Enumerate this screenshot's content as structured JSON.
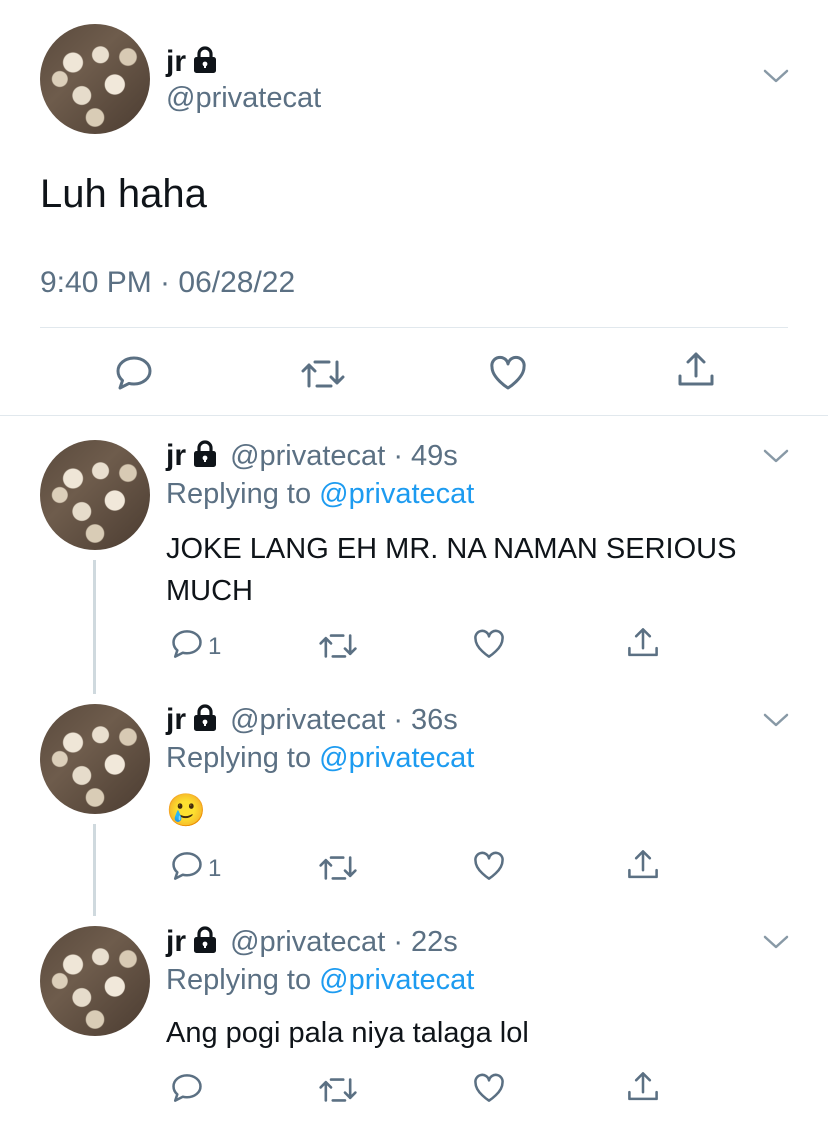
{
  "main_tweet": {
    "name": "jr",
    "handle": "@privatecat",
    "text": "Luh haha",
    "timestamp": "9:40 PM · 06/28/22"
  },
  "replies": [
    {
      "name": "jr",
      "handle": "@privatecat",
      "sep": "·",
      "time": "49s",
      "replying_prefix": "Replying to",
      "replying_to": "@privatecat",
      "text_line1": "JOKE LANG EH MR. NA NAMAN SERIOUS",
      "text_line2": "MUCH",
      "reply_count": "1"
    },
    {
      "name": "jr",
      "handle": "@privatecat",
      "sep": "·",
      "time": "36s",
      "replying_prefix": "Replying to",
      "replying_to": "@privatecat",
      "text": "🥲",
      "reply_count": "1"
    },
    {
      "name": "jr",
      "handle": "@privatecat",
      "sep": "·",
      "time": "22s",
      "replying_prefix": "Replying to",
      "replying_to": "@privatecat",
      "text": "Ang pogi pala niya talaga lol"
    }
  ],
  "icons": {
    "lock": "lock-icon",
    "chevron": "chevron-down-icon",
    "reply": "reply-icon",
    "retweet": "retweet-icon",
    "like": "heart-icon",
    "share": "share-icon"
  },
  "colors": {
    "text": "#0f1419",
    "secondary": "#5b7083",
    "link": "#1d9bf0",
    "divider": "#e1e8ed"
  }
}
